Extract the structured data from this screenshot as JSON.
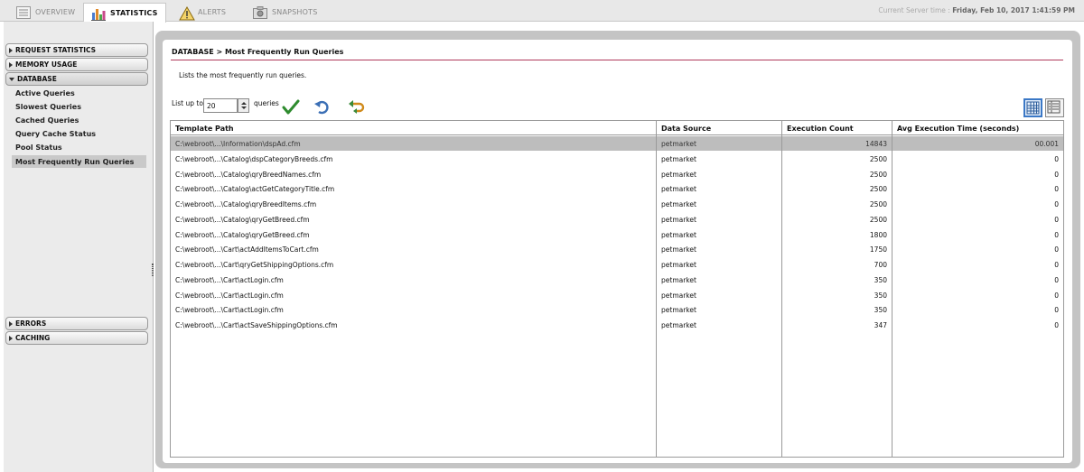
{
  "tabs": [
    {
      "label": "OVERVIEW",
      "icon": "list-icon"
    },
    {
      "label": "STATISTICS",
      "icon": "bar-chart-icon"
    },
    {
      "label": "ALERTS",
      "icon": "warning-icon"
    },
    {
      "label": "SNAPSHOTS",
      "icon": "camera-icon"
    }
  ],
  "server_time": {
    "label": "Current Server time :",
    "value": "Friday, Feb 10, 2017  1:41:59 PM"
  },
  "sidebar": {
    "sections": [
      {
        "label": "REQUEST STATISTICS"
      },
      {
        "label": "MEMORY USAGE"
      },
      {
        "label": "DATABASE"
      },
      {
        "label": "ERRORS"
      },
      {
        "label": "CACHING"
      }
    ],
    "database_items": [
      {
        "label": "Active Queries"
      },
      {
        "label": "Slowest Queries"
      },
      {
        "label": "Cached Queries"
      },
      {
        "label": "Query Cache Status"
      },
      {
        "label": "Pool Status"
      },
      {
        "label": "Most Frequently Run Queries"
      }
    ]
  },
  "main": {
    "breadcrumb": "DATABASE > Most Frequently Run Queries",
    "description": "Lists the most frequently run queries.",
    "list_up_to_label": "List up to",
    "list_up_to_value": "20",
    "queries_label": "queries",
    "columns": [
      "Template Path",
      "Data Source",
      "Execution Count",
      "Avg Execution Time (seconds)"
    ],
    "rows": [
      {
        "path": "C:\\webroot\\...\\Information\\dspAd.cfm",
        "source": "petmarket",
        "count": "14843",
        "avg": "00.001"
      },
      {
        "path": "C:\\webroot\\...\\Catalog\\dspCategoryBreeds.cfm",
        "source": "petmarket",
        "count": "2500",
        "avg": "0"
      },
      {
        "path": "C:\\webroot\\...\\Catalog\\qryBreedNames.cfm",
        "source": "petmarket",
        "count": "2500",
        "avg": "0"
      },
      {
        "path": "C:\\webroot\\...\\Catalog\\actGetCategoryTitle.cfm",
        "source": "petmarket",
        "count": "2500",
        "avg": "0"
      },
      {
        "path": "C:\\webroot\\...\\Catalog\\qryBreedItems.cfm",
        "source": "petmarket",
        "count": "2500",
        "avg": "0"
      },
      {
        "path": "C:\\webroot\\...\\Catalog\\qryGetBreed.cfm",
        "source": "petmarket",
        "count": "2500",
        "avg": "0"
      },
      {
        "path": "C:\\webroot\\...\\Catalog\\qryGetBreed.cfm",
        "source": "petmarket",
        "count": "1800",
        "avg": "0"
      },
      {
        "path": "C:\\webroot\\...\\Cart\\actAddItemsToCart.cfm",
        "source": "petmarket",
        "count": "1750",
        "avg": "0"
      },
      {
        "path": "C:\\webroot\\...\\Cart\\qryGetShippingOptions.cfm",
        "source": "petmarket",
        "count": "700",
        "avg": "0"
      },
      {
        "path": "C:\\webroot\\...\\Cart\\actLogin.cfm",
        "source": "petmarket",
        "count": "350",
        "avg": "0"
      },
      {
        "path": "C:\\webroot\\...\\Cart\\actLogin.cfm",
        "source": "petmarket",
        "count": "350",
        "avg": "0"
      },
      {
        "path": "C:\\webroot\\...\\Cart\\actLogin.cfm",
        "source": "petmarket",
        "count": "350",
        "avg": "0"
      },
      {
        "path": "C:\\webroot\\...\\Cart\\actSaveShippingOptions.cfm",
        "source": "petmarket",
        "count": "347",
        "avg": "0"
      }
    ]
  },
  "colors": {
    "accent_line": "#b03a5b",
    "selected_row": "#bdbdbd",
    "view_active": "#3b78c6"
  }
}
